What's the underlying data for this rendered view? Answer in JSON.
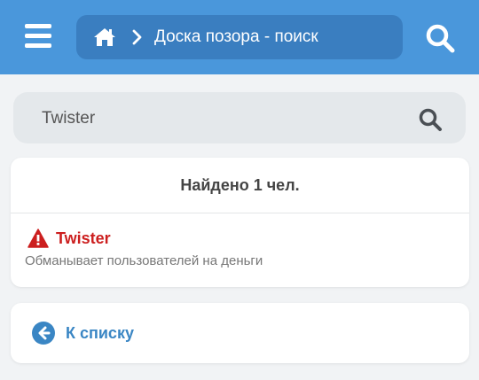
{
  "header": {
    "breadcrumb_title": "Доска позора - поиск",
    "icons": [
      "menu-icon",
      "home-icon",
      "chevron-right-icon",
      "search-icon"
    ],
    "colors": {
      "bar": "#4a97db",
      "crumb": "#3a7ec0"
    }
  },
  "search": {
    "value": "Twister",
    "icon": "search-icon"
  },
  "results": {
    "count_text": "Найдено 1 чел.",
    "items": [
      {
        "name": "Twister",
        "description": "Обманывает пользователей на деньги",
        "icon": "warning-icon",
        "color": "#cc1f1f"
      }
    ]
  },
  "back": {
    "label": "К списку",
    "icon": "arrow-left-circle-icon",
    "color": "#3a86c4"
  }
}
